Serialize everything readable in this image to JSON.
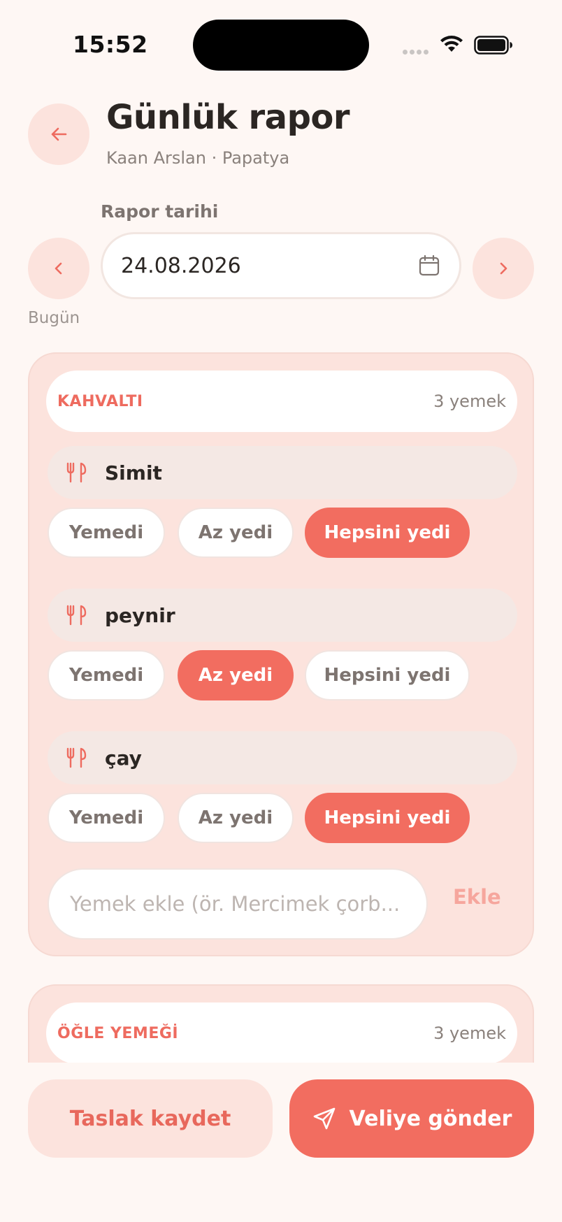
{
  "status_bar": {
    "time": "15:52"
  },
  "header": {
    "title": "Günlük rapor",
    "subtitle": "Kaan Arslan · Papatya",
    "back_icon": "arrow-left-icon"
  },
  "date": {
    "label": "Rapor tarihi",
    "value": "24.08.2026",
    "today_label": "Bugün",
    "prev_icon": "chevron-left-icon",
    "next_icon": "chevron-right-icon",
    "calendar_icon": "calendar-icon"
  },
  "meals": [
    {
      "title": "KAHVALTI",
      "count": "3 yemek",
      "foods": [
        {
          "name": "Simit",
          "selected": "Hepsini yedi"
        },
        {
          "name": "peynir",
          "selected": "Az yedi"
        },
        {
          "name": "çay",
          "selected": "Hepsini yedi"
        }
      ],
      "options": [
        "Yemedi",
        "Az yedi",
        "Hepsini yedi"
      ],
      "add_placeholder": "Yemek ekle (ör. Mercimek çorb...",
      "add_label": "Ekle"
    },
    {
      "title": "ÖĞLE YEMEĞİ",
      "count": "3 yemek"
    }
  ],
  "actions": {
    "draft_label": "Taslak kaydet",
    "send_label": "Veliye gönder",
    "send_icon": "send-icon"
  },
  "colors": {
    "accent": "#F26D60",
    "accent_soft": "#FCE3DD",
    "background": "#FEF7F4"
  }
}
